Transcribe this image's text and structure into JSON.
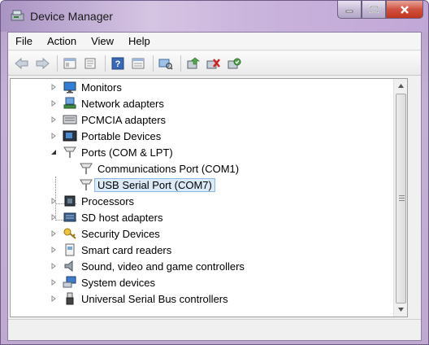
{
  "window": {
    "title": "Device Manager"
  },
  "menu": [
    "File",
    "Action",
    "View",
    "Help"
  ],
  "toolbar": {
    "buttons": [
      "back-arrow-icon",
      "forward-arrow-icon",
      "show-hide-tree-icon",
      "properties-icon",
      "help-icon",
      "view-icon",
      "scan-hardware-icon",
      "update-driver-icon",
      "uninstall-icon",
      "enable-disable-icon"
    ]
  },
  "tree": {
    "items": [
      {
        "label": "Monitors",
        "icon": "monitor-icon",
        "expanded": false
      },
      {
        "label": "Network adapters",
        "icon": "network-icon",
        "expanded": false
      },
      {
        "label": "PCMCIA adapters",
        "icon": "pcmcia-icon",
        "expanded": false
      },
      {
        "label": "Portable Devices",
        "icon": "portable-device-icon",
        "expanded": false
      },
      {
        "label": "Ports (COM & LPT)",
        "icon": "port-icon",
        "expanded": true,
        "children": [
          {
            "label": "Communications Port (COM1)",
            "icon": "port-icon"
          },
          {
            "label": "USB Serial Port (COM7)",
            "icon": "port-icon",
            "selected": true
          }
        ]
      },
      {
        "label": "Processors",
        "icon": "processor-icon",
        "expanded": false
      },
      {
        "label": "SD host adapters",
        "icon": "sd-host-icon",
        "expanded": false
      },
      {
        "label": "Security Devices",
        "icon": "security-key-icon",
        "expanded": false
      },
      {
        "label": "Smart card readers",
        "icon": "smart-card-icon",
        "expanded": false
      },
      {
        "label": "Sound, video and game controllers",
        "icon": "speaker-icon",
        "expanded": false
      },
      {
        "label": "System devices",
        "icon": "system-devices-icon",
        "expanded": false
      },
      {
        "label": "Universal Serial Bus controllers",
        "icon": "usb-icon",
        "expanded": false
      }
    ]
  },
  "status": {
    "text": ""
  }
}
